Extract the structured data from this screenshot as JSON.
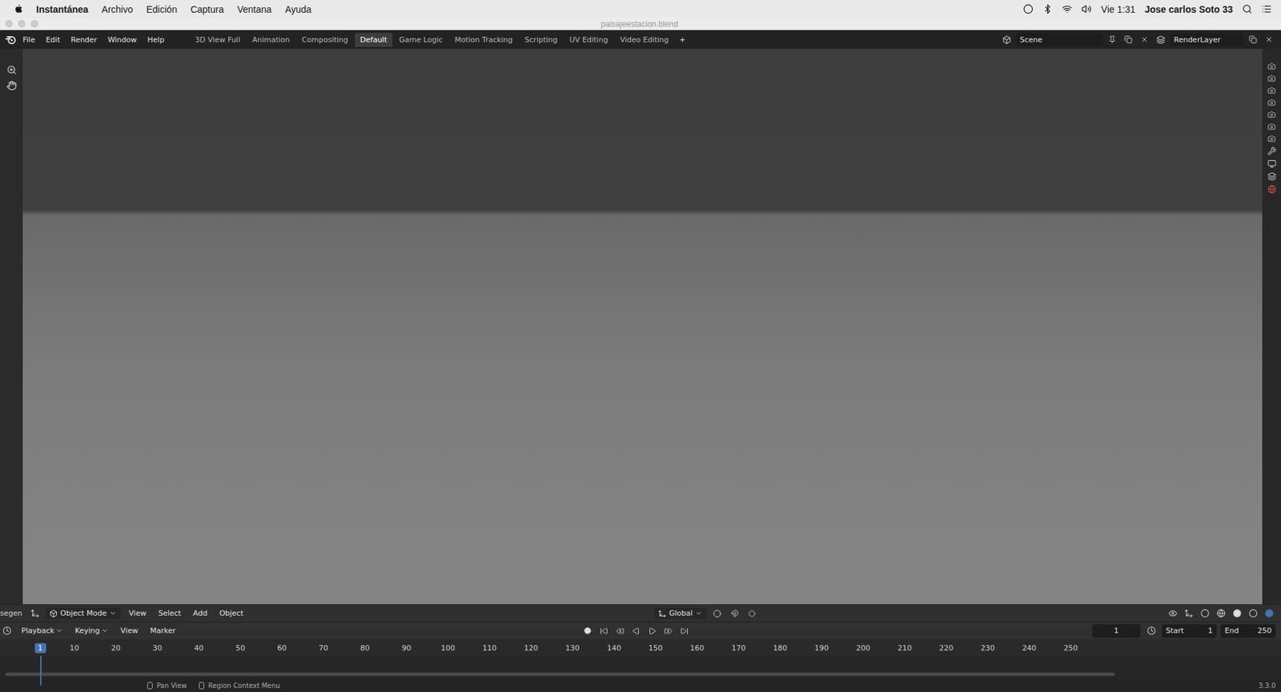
{
  "menu_bar": {
    "app": "Instantánea",
    "items": [
      "Archivo",
      "Edición",
      "Captura",
      "Ventana",
      "Ayuda"
    ],
    "clock": "Vie 1:31",
    "user": "Jose carlos Soto 33"
  },
  "window": {
    "title": "paisajeestacion.blend"
  },
  "top_bar": {
    "menus": [
      "File",
      "Edit",
      "Render",
      "Window",
      "Help"
    ],
    "workspaces": [
      {
        "label": "3D View Full",
        "selected": false
      },
      {
        "label": "Animation",
        "selected": false
      },
      {
        "label": "Compositing",
        "selected": false
      },
      {
        "label": "Default",
        "selected": true
      },
      {
        "label": "Game Logic",
        "selected": false
      },
      {
        "label": "Motion Tracking",
        "selected": false
      },
      {
        "label": "Scripting",
        "selected": false
      },
      {
        "label": "UV Editing",
        "selected": false
      },
      {
        "label": "Video Editing",
        "selected": false
      }
    ],
    "add_tab": "+",
    "scene": "Scene",
    "render_layer": "RenderLayer"
  },
  "viewport_header": {
    "side_label": "segen",
    "mode": "Object Mode",
    "menus": [
      "View",
      "Select",
      "Add",
      "Object"
    ],
    "orientation": "Global"
  },
  "timeline": {
    "menus": [
      {
        "label": "Playback",
        "dropdown": true
      },
      {
        "label": "Keying",
        "dropdown": true
      },
      {
        "label": "View",
        "dropdown": false
      },
      {
        "label": "Marker",
        "dropdown": false
      }
    ],
    "current_frame": "1",
    "start_label": "Start",
    "start": "1",
    "end_label": "End",
    "end": "250",
    "playhead": "1",
    "ruler": [
      "10",
      "20",
      "30",
      "40",
      "50",
      "60",
      "70",
      "80",
      "90",
      "100",
      "110",
      "120",
      "130",
      "140",
      "150",
      "160",
      "170",
      "180",
      "190",
      "200",
      "210",
      "220",
      "230",
      "240",
      "250"
    ]
  },
  "status_bar": {
    "hints": [
      "Pan View",
      "Region Context Menu"
    ],
    "version": "3.3.0"
  }
}
